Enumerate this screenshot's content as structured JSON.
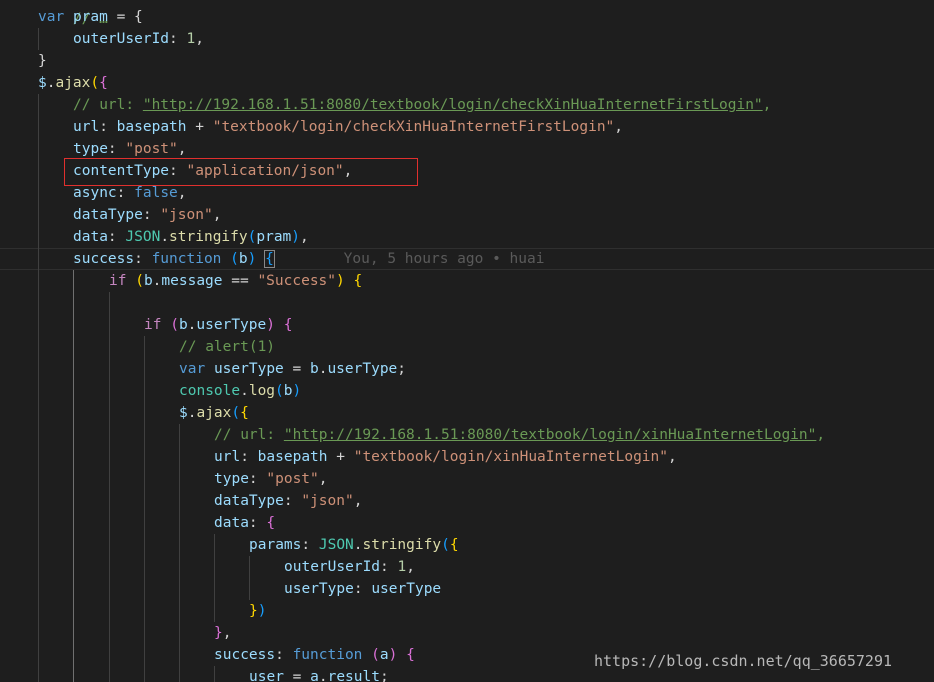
{
  "code": {
    "l0": "// …",
    "l1_kw": "var",
    "l1_var": "pram",
    "l1_rest": " = {",
    "l2_prop": "outerUserId",
    "l2_num": "1",
    "l3": "}",
    "l4_obj": "$",
    "l4_fn": "ajax",
    "l5_cmt": "// url: ",
    "l5_url": "\"http://192.168.1.51:8080/textbook/login/checkXinHuaInternetFirstLogin\"",
    "l6_prop": "url",
    "l6_var": "basepath",
    "l6_str": "\"textbook/login/checkXinHuaInternetFirstLogin\"",
    "l7_prop": "type",
    "l7_str": "\"post\"",
    "l8_prop": "contentType",
    "l8_str": "\"application/json\"",
    "l9_prop": "async",
    "l9_kw": "false",
    "l10_prop": "dataType",
    "l10_str": "\"json\"",
    "l11_prop": "data",
    "l11_cls": "JSON",
    "l11_fn": "stringify",
    "l11_var": "pram",
    "l12_prop": "success",
    "l12_kw": "function",
    "l12_param": "b",
    "l12_blame": "You, 5 hours ago • huai",
    "l13_kw": "if",
    "l13_var": "b",
    "l13_prop": "message",
    "l13_str": "\"Success\"",
    "l15_kw": "if",
    "l15_var": "b",
    "l15_prop": "userType",
    "l16_cmt": "// alert(1)",
    "l17_kw": "var",
    "l17_var": "userType",
    "l17_var2": "b",
    "l17_prop": "userType",
    "l18_var": "console",
    "l18_fn": "log",
    "l18_arg": "b",
    "l19_obj": "$",
    "l19_fn": "ajax",
    "l20_cmt": "// url: ",
    "l20_url": "\"http://192.168.1.51:8080/textbook/login/xinHuaInternetLogin\"",
    "l21_prop": "url",
    "l21_var": "basepath",
    "l21_str": "\"textbook/login/xinHuaInternetLogin\"",
    "l22_prop": "type",
    "l22_str": "\"post\"",
    "l23_prop": "dataType",
    "l23_str": "\"json\"",
    "l24_prop": "data",
    "l25_prop": "params",
    "l25_cls": "JSON",
    "l25_fn": "stringify",
    "l26_prop": "outerUserId",
    "l26_num": "1",
    "l27_prop": "userType",
    "l27_var": "userType",
    "l30_prop": "success",
    "l30_kw": "function",
    "l30_param": "a",
    "l31_var": "user",
    "l31_var2": "a",
    "l31_prop": "result"
  },
  "watermark": "https://blog.csdn.net/qq_36657291",
  "colors": {
    "background": "#1e1e1e",
    "keyword": "#569cd6",
    "variable": "#9cdcfe",
    "string": "#ce9178",
    "number": "#b5cea8",
    "comment": "#6a9955",
    "function": "#dcdcaa",
    "class": "#4ec9b0",
    "highlight_border": "#e0302e"
  }
}
